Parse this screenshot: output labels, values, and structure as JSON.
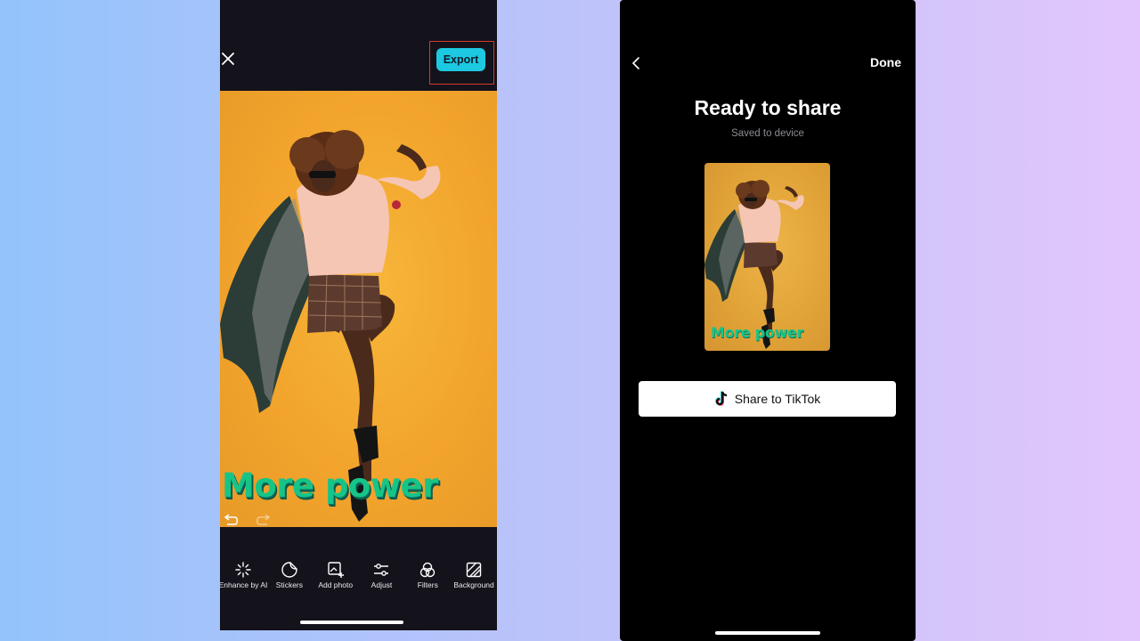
{
  "editor": {
    "close_icon": "close-icon",
    "export_label": "Export",
    "overlay_text": "More power",
    "undo_icon": "undo-icon",
    "redo_icon": "redo-icon",
    "tools": [
      {
        "label": "Enhance by AI",
        "icon": "sparkle-icon"
      },
      {
        "label": "Stickers",
        "icon": "sticker-icon"
      },
      {
        "label": "Add photo",
        "icon": "add-photo-icon"
      },
      {
        "label": "Adjust",
        "icon": "sliders-icon"
      },
      {
        "label": "Filters",
        "icon": "filters-icon"
      },
      {
        "label": "Background",
        "icon": "background-icon"
      }
    ],
    "colors": {
      "accent": "#1dc9e0",
      "highlight_border": "#d63a2a",
      "canvas_background": "#f2a42c",
      "text_overlay": "#17c488"
    }
  },
  "share": {
    "back_icon": "chevron-left-icon",
    "done_label": "Done",
    "title": "Ready to share",
    "subtitle": "Saved to device",
    "preview_text": "More power",
    "tiktok_label": "Share to TikTok",
    "tiktok_icon": "tiktok-icon"
  }
}
